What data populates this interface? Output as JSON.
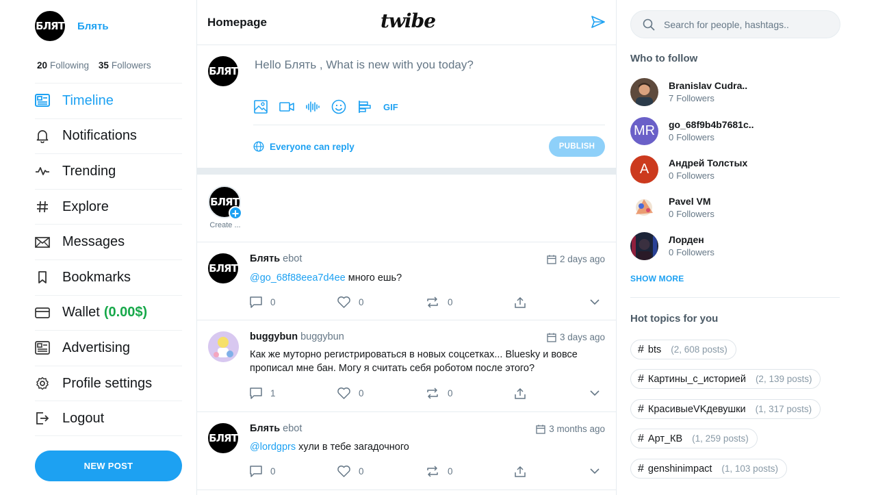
{
  "sidebar": {
    "avatar_text": "БЛЯТ",
    "username": "Блять",
    "following_count": "20",
    "following_label": "Following",
    "followers_count": "35",
    "followers_label": "Followers",
    "nav": [
      {
        "label": "Timeline",
        "icon": "timeline-icon",
        "active": true
      },
      {
        "label": "Notifications",
        "icon": "bell-icon"
      },
      {
        "label": "Trending",
        "icon": "trending-icon"
      },
      {
        "label": "Explore",
        "icon": "hash-icon"
      },
      {
        "label": "Messages",
        "icon": "envelope-icon"
      },
      {
        "label": "Bookmarks",
        "icon": "bookmark-icon"
      },
      {
        "label": "Wallet",
        "icon": "wallet-icon",
        "amount": "(0.00$)"
      },
      {
        "label": "Advertising",
        "icon": "advertising-icon"
      },
      {
        "label": "Profile settings",
        "icon": "gear-icon"
      },
      {
        "label": "Logout",
        "icon": "logout-icon"
      }
    ],
    "new_post_label": "NEW POST"
  },
  "header": {
    "title": "Homepage",
    "logo": "twibe"
  },
  "composer": {
    "prompt": "Hello Блять , What is new with you today?",
    "gif_label": "GIF",
    "reply_setting": "Everyone can reply",
    "publish_label": "PUBLISH"
  },
  "stories": {
    "create_label": "Create ..."
  },
  "posts": [
    {
      "name": "Блять",
      "handle": "ebot",
      "time": "2 days ago",
      "mention": "@go_68f88eea7d4ee",
      "text": " много ешь?",
      "comments": "0",
      "likes": "0",
      "reposts": "0"
    },
    {
      "name": "buggybun",
      "handle": "buggybun",
      "time": "3 days ago",
      "mention": "",
      "text": "Как же муторно регистрироваться в новых соцсетках... Bluesky и вовсе прописал мне бан. Могу я считать себя роботом после этого?",
      "comments": "1",
      "likes": "0",
      "reposts": "0"
    },
    {
      "name": "Блять",
      "handle": "ebot",
      "time": "3 months ago",
      "mention": "@lordgprs",
      "text": " хули в тебе загадочного",
      "comments": "0",
      "likes": "0",
      "reposts": "0"
    }
  ],
  "right": {
    "search_placeholder": "Search for people, hashtags..",
    "who_to_follow_title": "Who to follow",
    "suggestions": [
      {
        "name": "Branislav Cudra..",
        "followers": "7",
        "followers_label": "Followers",
        "initials": "",
        "color": "#8a6a52"
      },
      {
        "name": "go_68f9b4b7681c..",
        "followers": "0",
        "followers_label": "Followers",
        "initials": "MR",
        "color": "#6a60c8"
      },
      {
        "name": "Андрей Толстых",
        "followers": "0",
        "followers_label": "Followers",
        "initials": "A",
        "color": "#cc3a1e"
      },
      {
        "name": "Pavel VM",
        "followers": "0",
        "followers_label": "Followers",
        "initials": "",
        "color": "#e8d8c8"
      },
      {
        "name": "Лорден",
        "followers": "0",
        "followers_label": "Followers",
        "initials": "",
        "color": "#1c2438"
      }
    ],
    "show_more_label": "SHOW MORE",
    "hot_topics_title": "Hot topics for you",
    "topics": [
      {
        "tag": "bts",
        "count": "(2, 608 posts)"
      },
      {
        "tag": "Картины_с_историей",
        "count": "(2, 139 posts)"
      },
      {
        "tag": "КрасивыеVKдевушки",
        "count": "(1, 317 posts)"
      },
      {
        "tag": "Арт_КВ",
        "count": "(1, 259 posts)"
      },
      {
        "tag": "genshinimpact",
        "count": "(1, 103 posts)"
      }
    ]
  },
  "colors": {
    "accent": "#1da1f2",
    "wallet_green": "#17a84a",
    "muted": "#657786"
  }
}
